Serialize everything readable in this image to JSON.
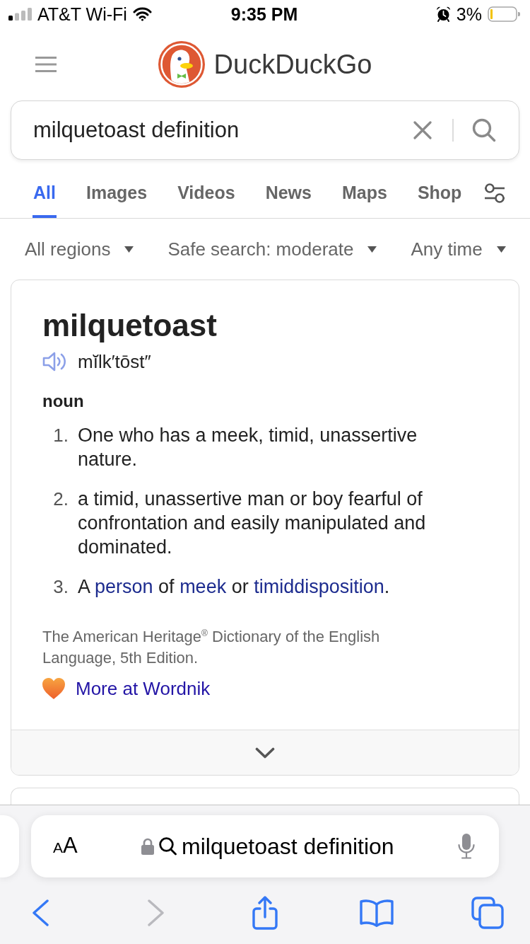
{
  "status_bar": {
    "carrier": "AT&T Wi-Fi",
    "time": "9:35 PM",
    "battery": "3%"
  },
  "header": {
    "brand": "DuckDuckGo"
  },
  "search": {
    "value": "milquetoast definition"
  },
  "tabs": [
    {
      "label": "All",
      "selected": true
    },
    {
      "label": "Images",
      "selected": false
    },
    {
      "label": "Videos",
      "selected": false
    },
    {
      "label": "News",
      "selected": false
    },
    {
      "label": "Maps",
      "selected": false
    },
    {
      "label": "Shop",
      "selected": false
    }
  ],
  "filters": [
    {
      "label": "All regions"
    },
    {
      "label": "Safe search: moderate"
    },
    {
      "label": "Any time"
    }
  ],
  "definition": {
    "word": "milquetoast",
    "pronunciation": "mĭlk′tōst″",
    "part_of_speech": "noun",
    "senses": [
      {
        "number": "1.",
        "text": "One who has a meek, timid, unassertive nature."
      },
      {
        "number": "2.",
        "text": "a timid, unassertive man or boy fearful of confrontation and easily manipulated and dominated."
      },
      {
        "number": "3.",
        "segments": [
          {
            "kind": "text",
            "text": "A "
          },
          {
            "kind": "link",
            "text": "person"
          },
          {
            "kind": "text",
            "text": " of "
          },
          {
            "kind": "link",
            "text": "meek"
          },
          {
            "kind": "text",
            "text": " or "
          },
          {
            "kind": "link",
            "text": "timiddisposition"
          },
          {
            "kind": "text",
            "text": "."
          }
        ]
      }
    ],
    "source": "The American Heritage$^{®}$ Dictionary of the English Language, 5th Edition.",
    "more_link": "More at Wordnik"
  },
  "address_bar": {
    "text_size": "AA",
    "value": "milquetoast definition"
  },
  "toolbar": [
    {
      "kind": "back",
      "disabled": false
    },
    {
      "kind": "forward",
      "disabled": true
    },
    {
      "kind": "share",
      "disabled": false
    },
    {
      "kind": "bookmarks",
      "disabled": false
    },
    {
      "kind": "tabs",
      "disabled": false
    }
  ]
}
